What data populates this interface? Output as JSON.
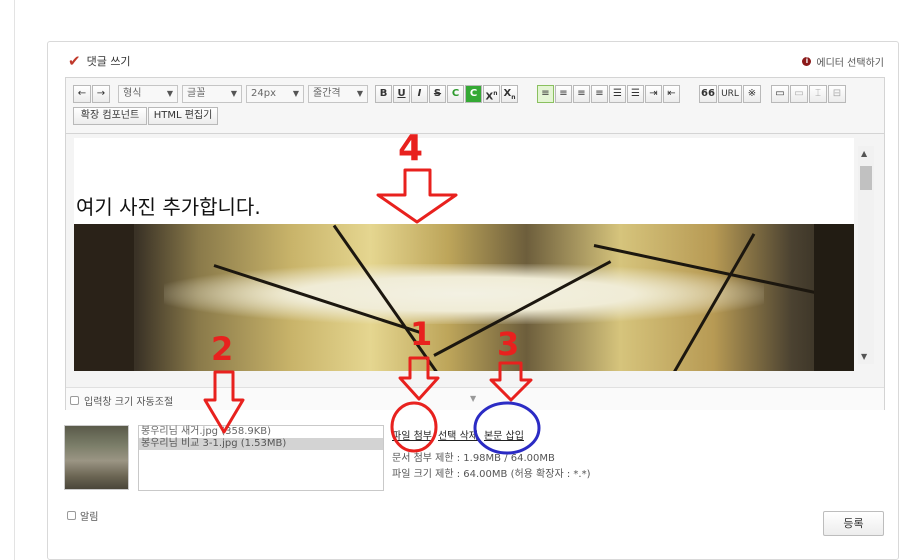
{
  "header": {
    "top_fragment": "· · · ·",
    "title": "댓글 쓰기",
    "editor_select": "에디터 선택하기"
  },
  "toolbar": {
    "undo": "←",
    "redo": "→",
    "format_select": "형식",
    "font_select": "글꼴",
    "size_select": "24px",
    "line_select": "줄간격",
    "bold": "B",
    "underline": "U",
    "italic": "I",
    "strike": "S",
    "color": "C",
    "bgcolor": "C",
    "sup": "X",
    "sub": "X",
    "quote": "66",
    "url": "URL",
    "special": "※",
    "ext_component": "확장 컴포넌트",
    "html_editor": "HTML 편집기"
  },
  "content": {
    "text": "여기 사진 추가합니다."
  },
  "resize": {
    "label": "입력창 크기 자동조절"
  },
  "files": {
    "items": [
      {
        "name": "봉우리님 새거.jpg (358.9KB)",
        "selected": false
      },
      {
        "name": "봉우리님 비교 3-1.jpg (1.53MB)",
        "selected": true
      }
    ],
    "attach": "파일 첨부",
    "delete": "선택 삭제",
    "insert": "본문 삽입",
    "limit_total": "문서 첨부 제한 : 1.98MB / 64.00MB",
    "limit_file": "파일 크기 제한 : 64.00MB (허용 확장자 : *.*)"
  },
  "notify": {
    "label": "알림"
  },
  "submit": {
    "label": "등록"
  },
  "annotations": {
    "n4": "4",
    "n2": "2",
    "n1": "1",
    "n3": "3"
  },
  "colors": {
    "check": "#c0392b",
    "annotation_red": "#e8211e",
    "annotation_blue": "#2b2bc4",
    "active_button": "#e4f5d4"
  }
}
